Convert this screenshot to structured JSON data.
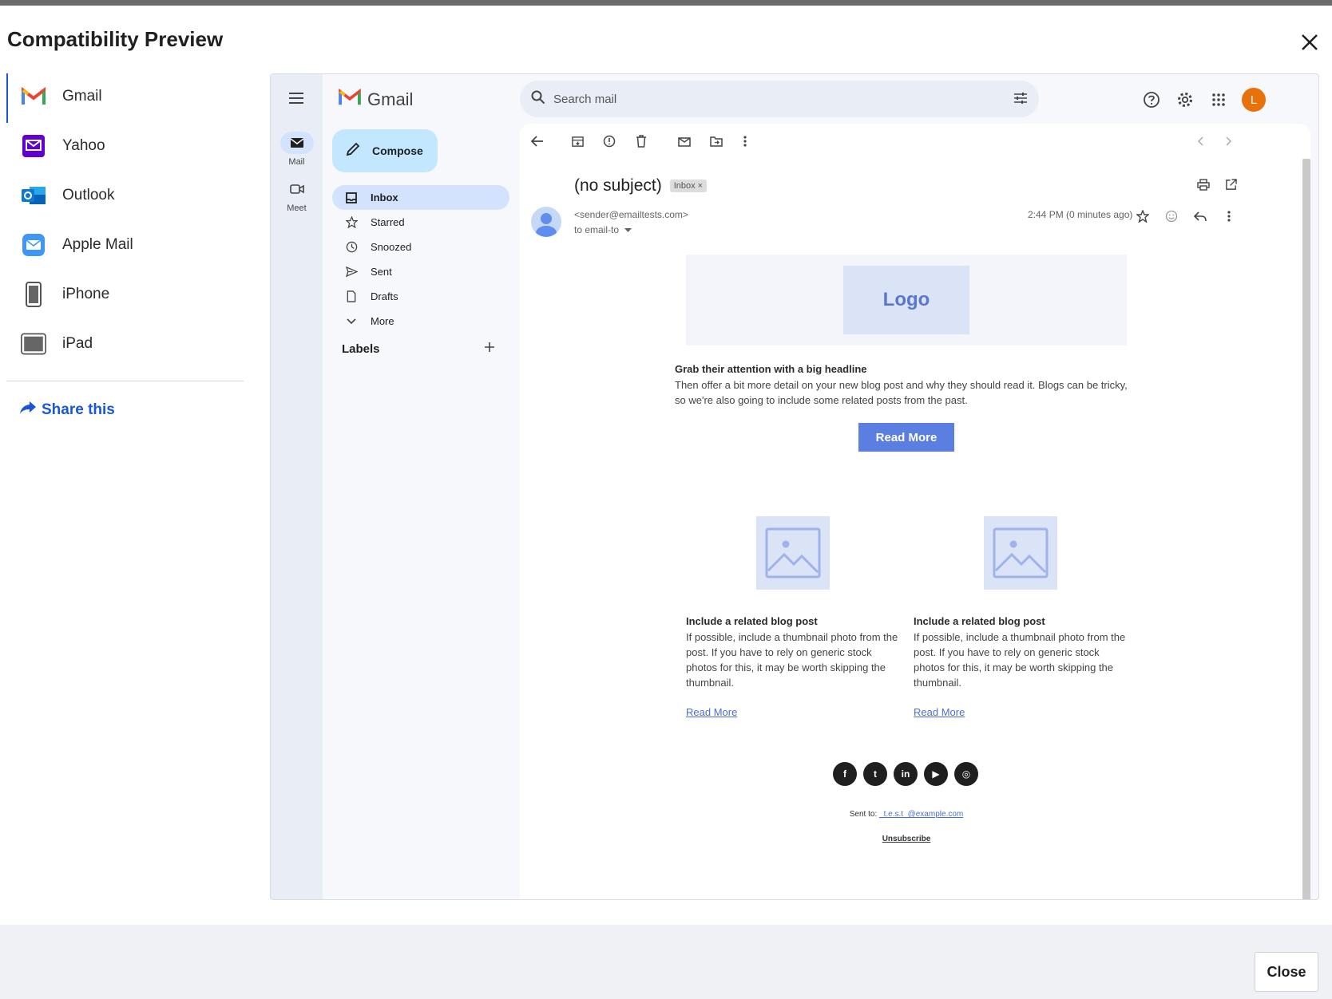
{
  "modal": {
    "title": "Compatibility Preview",
    "close_label": "Close"
  },
  "clients": [
    {
      "label": "Gmail",
      "icon": "gmail-icon",
      "active": true
    },
    {
      "label": "Yahoo",
      "icon": "yahoo-icon",
      "active": false
    },
    {
      "label": "Outlook",
      "icon": "outlook-icon",
      "active": false
    },
    {
      "label": "Apple Mail",
      "icon": "apple-mail-icon",
      "active": false
    },
    {
      "label": "iPhone",
      "icon": "iphone-icon",
      "active": false
    },
    {
      "label": "iPad",
      "icon": "ipad-icon",
      "active": false
    }
  ],
  "share": {
    "label": "Share this"
  },
  "gmail": {
    "brand": "Gmail",
    "rail": [
      {
        "label": "Mail",
        "icon": "mail-icon"
      },
      {
        "label": "Meet",
        "icon": "meet-icon"
      }
    ],
    "compose_label": "Compose",
    "nav": [
      {
        "label": "Inbox",
        "icon": "inbox-icon"
      },
      {
        "label": "Starred",
        "icon": "star-icon"
      },
      {
        "label": "Snoozed",
        "icon": "clock-icon"
      },
      {
        "label": "Sent",
        "icon": "send-icon"
      },
      {
        "label": "Drafts",
        "icon": "draft-icon"
      },
      {
        "label": "More",
        "icon": "chevron-down-icon"
      }
    ],
    "labels_heading": "Labels",
    "search_placeholder": "Search mail",
    "avatar_initial": "L"
  },
  "message": {
    "subject": "(no subject)",
    "chip": "Inbox ×",
    "sender": "<sender@emailtests.com>",
    "to": "to email-to",
    "time": "2:44 PM (0 minutes ago)"
  },
  "email": {
    "logo": "Logo",
    "headline": "Grab their attention with a big headline",
    "paragraph": "Then offer a bit more detail on your new blog post and why they should read it. Blogs can be tricky, so we're also going to include some related posts from the past.",
    "button": "Read More",
    "columns": [
      {
        "heading": "Include a related blog post",
        "text": "If possible, include a thumbnail photo from the post. If you have to rely on generic stock photos for this, it may be worth skipping the thumbnail.",
        "link": "Read More"
      },
      {
        "heading": "Include a related blog post",
        "text": "If possible, include a thumbnail photo from the post. If you have to rely on generic stock photos for this, it may be worth skipping the thumbnail.",
        "link": "Read More"
      }
    ],
    "social": [
      {
        "name": "facebook",
        "glyph": "f"
      },
      {
        "name": "twitter",
        "glyph": "t"
      },
      {
        "name": "linkedin",
        "glyph": "in"
      },
      {
        "name": "youtube",
        "glyph": "▶"
      },
      {
        "name": "instagram",
        "glyph": "◎"
      }
    ],
    "sent_to_label": "Sent to:",
    "sent_to_email": "_t.e.s.t_@example.com",
    "unsubscribe": "Unsubscribe"
  },
  "colors": {
    "accent": "#1a56db",
    "gmail_active": "#d3e3fd",
    "compose": "#c2e7ff",
    "email_button": "#5b7fe0",
    "avatar": "#e8710a"
  }
}
